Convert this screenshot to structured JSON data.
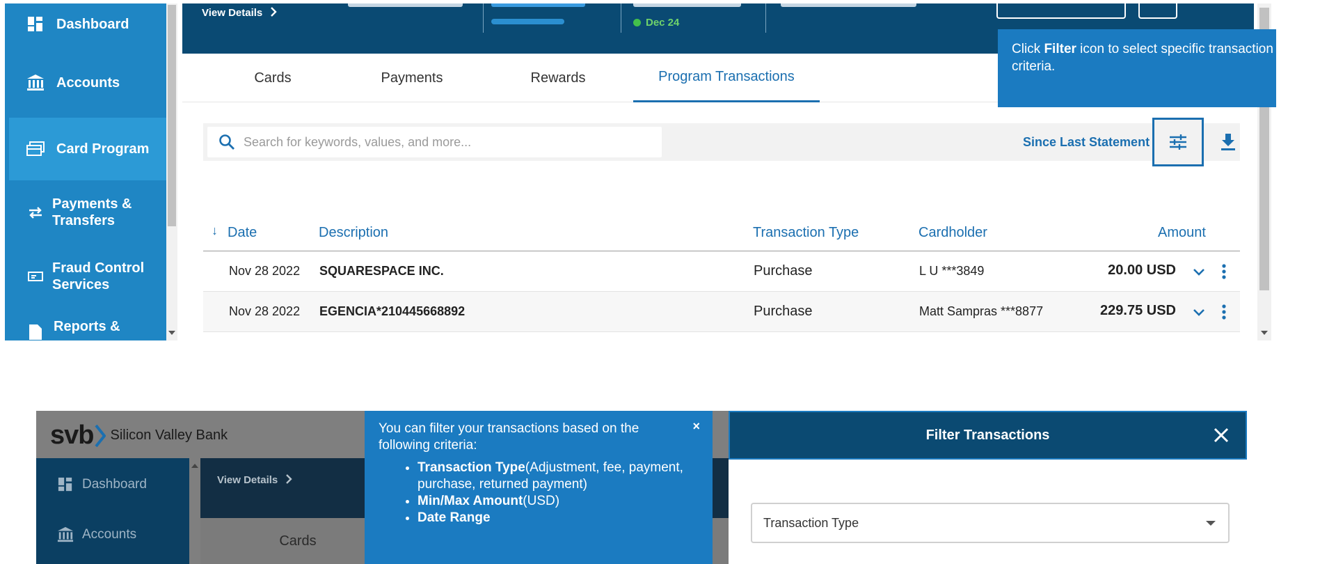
{
  "top": {
    "sidebar": {
      "items": [
        {
          "label": "Dashboard",
          "icon": "dashboard-icon"
        },
        {
          "label": "Accounts",
          "icon": "bank-icon"
        },
        {
          "label": "Card Program",
          "icon": "cards-icon"
        },
        {
          "label": "Payments &\nTransfers",
          "icon": "transfer-icon"
        },
        {
          "label": "Fraud Control\nServices",
          "icon": "id-card-icon"
        },
        {
          "label": "Reports &",
          "icon": "report-icon"
        }
      ]
    },
    "header": {
      "view_details": "View Details",
      "date": "Dec 24"
    },
    "tabs": [
      "Cards",
      "Payments",
      "Rewards",
      "Program Transactions"
    ],
    "search": {
      "placeholder": "Search for keywords, values, and more..."
    },
    "period": "Since Last Statement",
    "tooltip": {
      "pre": "Click ",
      "strong": "Filter",
      "post": " icon to select specific transaction",
      "line2": "criteria."
    },
    "table": {
      "headers": [
        "Date",
        "Description",
        "Transaction Type",
        "Cardholder",
        "Amount"
      ],
      "rows": [
        {
          "date": "Nov 28 2022",
          "description": "SQUARESPACE INC.",
          "type": "Purchase",
          "cardholder": "L U ***3849",
          "amount": "20.00 USD"
        },
        {
          "date": "Nov 28 2022",
          "description": "EGENCIA*210445668892",
          "type": "Purchase",
          "cardholder": "Matt Sampras ***8877",
          "amount": "229.75 USD"
        }
      ]
    }
  },
  "bottom": {
    "logo": {
      "mark": "svb",
      "name": "Silicon Valley Bank"
    },
    "sidebar": [
      {
        "label": "Dashboard",
        "icon": "dashboard-icon"
      },
      {
        "label": "Accounts",
        "icon": "bank-icon"
      }
    ],
    "view_details": "View Details",
    "cards_tab": "Cards",
    "tooltip": {
      "intro": "You can filter your transactions based on the following criteria:",
      "close": "×",
      "items": [
        {
          "strong": "Transaction Type",
          "rest": "(Adjustment, fee, payment, purchase, returned payment)"
        },
        {
          "strong": "Min/Max Amount",
          "rest": "(USD)"
        },
        {
          "strong": "Date Range",
          "rest": ""
        }
      ]
    },
    "filter_panel": {
      "title": "Filter Transactions",
      "select_label": "Transaction Type"
    }
  },
  "colors": {
    "sidebar_blue": "#1f86c4",
    "header_navy": "#0a4a73",
    "accent": "#1b6fb0",
    "tooltip_blue": "#1b7bc1",
    "status_green": "#43c04b"
  }
}
